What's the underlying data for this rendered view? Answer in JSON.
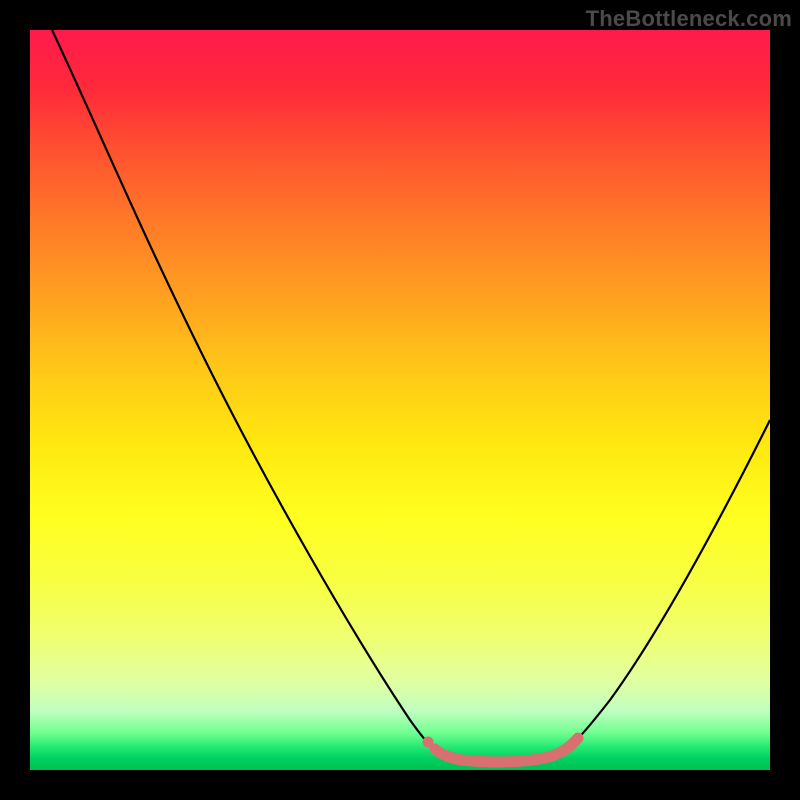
{
  "watermark": "TheBottleneck.com",
  "chart_data": {
    "type": "line",
    "title": "",
    "xlabel": "",
    "ylabel": "",
    "xlim": [
      0,
      100
    ],
    "ylim": [
      0,
      100
    ],
    "series": [
      {
        "name": "bottleneck-curve",
        "x": [
          3,
          10,
          20,
          30,
          40,
          48,
          53,
          56,
          60,
          65,
          68,
          72,
          78,
          85,
          92,
          100
        ],
        "y": [
          100,
          87,
          68,
          49,
          30,
          14,
          5,
          2,
          1,
          1,
          2,
          4,
          10,
          20,
          32,
          48
        ]
      },
      {
        "name": "optimal-zone",
        "x": [
          55,
          58,
          62,
          66,
          70,
          72
        ],
        "y": [
          2.5,
          1.5,
          1.0,
          1.2,
          2.5,
          3.5
        ]
      }
    ],
    "annotations": []
  }
}
